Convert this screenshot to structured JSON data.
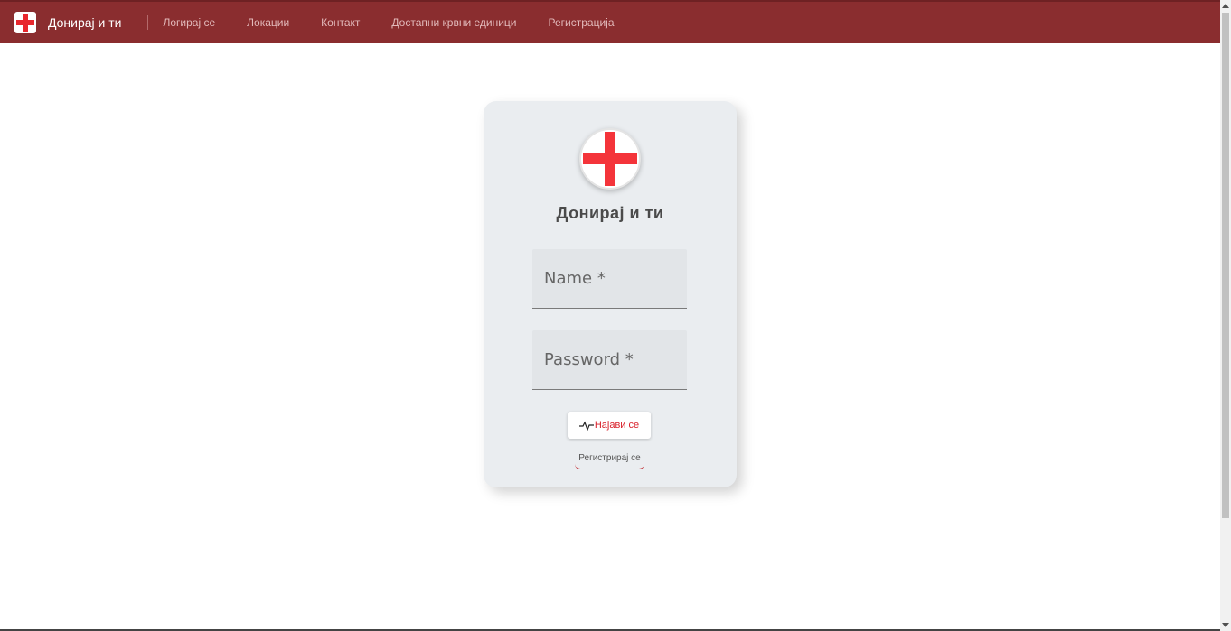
{
  "navbar": {
    "brand_title": "Донирај и ти",
    "links": [
      {
        "label": "Логирај се"
      },
      {
        "label": "Локации"
      },
      {
        "label": "Контакт"
      },
      {
        "label": "Достапни крвни единици"
      },
      {
        "label": "Регистрација"
      }
    ],
    "background_color": "#8a2d2f"
  },
  "login_card": {
    "logo_icon": "red-cross-icon",
    "title": "Донирај и ти",
    "name_placeholder": "Name *",
    "password_placeholder": "Password *",
    "login_button_icon": "pulse-icon",
    "login_button_label": "Најави се",
    "register_link_label": "Регистрирај се",
    "accent_color": "#d8202a"
  }
}
